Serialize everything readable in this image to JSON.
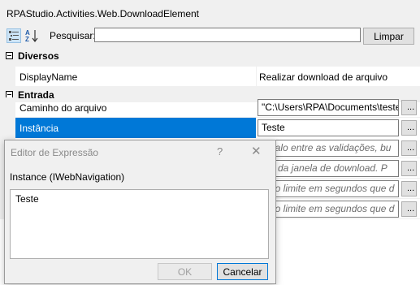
{
  "window": {
    "title": "RPAStudio.Activities.Web.DownloadElement"
  },
  "toolbar": {
    "categorized_icon": "categorized-view-icon",
    "alphabetical_icon": "alphabetical-sort-icon",
    "search_label": "Pesquisar:",
    "search_value": "",
    "clear_label": "Limpar"
  },
  "categories": [
    {
      "label": "Diversos",
      "rows": [
        {
          "name": "DisplayName",
          "value": "Realizar download de arquivo"
        }
      ]
    },
    {
      "label": "Entrada",
      "rows": [
        {
          "name": "Caminho do arquivo",
          "value": "\"C:\\Users\\RPA\\Documents\\teste"
        },
        {
          "name": "Instância",
          "value": "Teste",
          "selected": true
        },
        {
          "name": "",
          "value": "ervalo entre as validações, bu"
        },
        {
          "name": "",
          "value": "me da janela de download. P"
        },
        {
          "name": "",
          "value": "mpo limite em segundos que d"
        },
        {
          "name": "",
          "value": "mpo limite em segundos que d"
        }
      ]
    }
  ],
  "ellipsis_label": "...",
  "dialog": {
    "title": "Editor de Expressão",
    "help_glyph": "?",
    "close_glyph": "✕",
    "label": "Instance (IWebNavigation)",
    "text": "Teste",
    "ok_label": "OK",
    "cancel_label": "Cancelar"
  },
  "colors": {
    "selection": "#0078d7",
    "background": "#f0f0f0",
    "placeholder": "#6d6d6d"
  }
}
